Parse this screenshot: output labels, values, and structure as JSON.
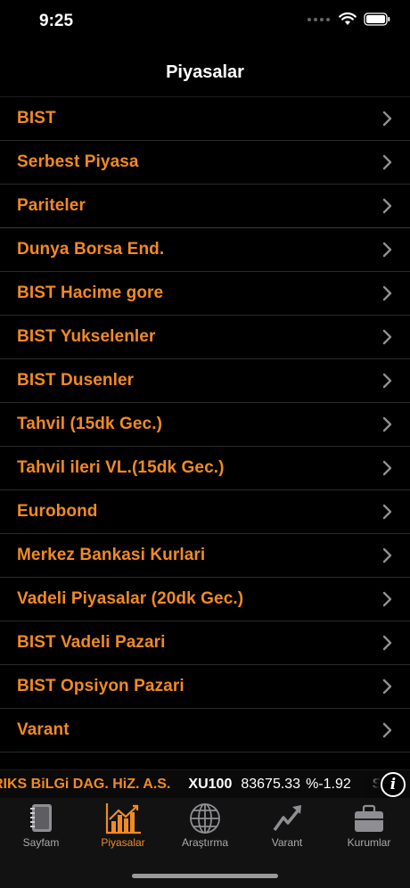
{
  "status_bar": {
    "time": "9:25"
  },
  "nav": {
    "title": "Piyasalar"
  },
  "menu": [
    {
      "label": "BIST"
    },
    {
      "label": "Serbest Piyasa"
    },
    {
      "label": "Pariteler"
    },
    {
      "label": "Dunya Borsa End."
    },
    {
      "label": "BIST Hacime gore"
    },
    {
      "label": "BIST Yukselenler"
    },
    {
      "label": "BIST Dusenler"
    },
    {
      "label": "Tahvil (15dk Gec.)"
    },
    {
      "label": "Tahvil ileri VL.(15dk Gec.)"
    },
    {
      "label": "Eurobond"
    },
    {
      "label": "Merkez Bankasi Kurlari"
    },
    {
      "label": "Vadeli Piyasalar (20dk Gec.)"
    },
    {
      "label": "BIST Vadeli Pazari"
    },
    {
      "label": "BIST Opsiyon Pazari"
    },
    {
      "label": "Varant"
    }
  ],
  "ticker": {
    "company": "RIKS BiLGi DAG. HiZ. A.S.",
    "symbol": "XU100",
    "value": "83675.33",
    "change": "%-1.92",
    "next": "S"
  },
  "tabs": [
    {
      "label": "Sayfam",
      "icon": "notebook-icon"
    },
    {
      "label": "Piyasalar",
      "icon": "bar-chart-icon",
      "active": true
    },
    {
      "label": "Araştırma",
      "icon": "globe-icon"
    },
    {
      "label": "Varant",
      "icon": "trend-arrow-icon"
    },
    {
      "label": "Kurumlar",
      "icon": "briefcase-icon"
    }
  ],
  "colors": {
    "accent": "#f08a24",
    "background": "#000000"
  }
}
